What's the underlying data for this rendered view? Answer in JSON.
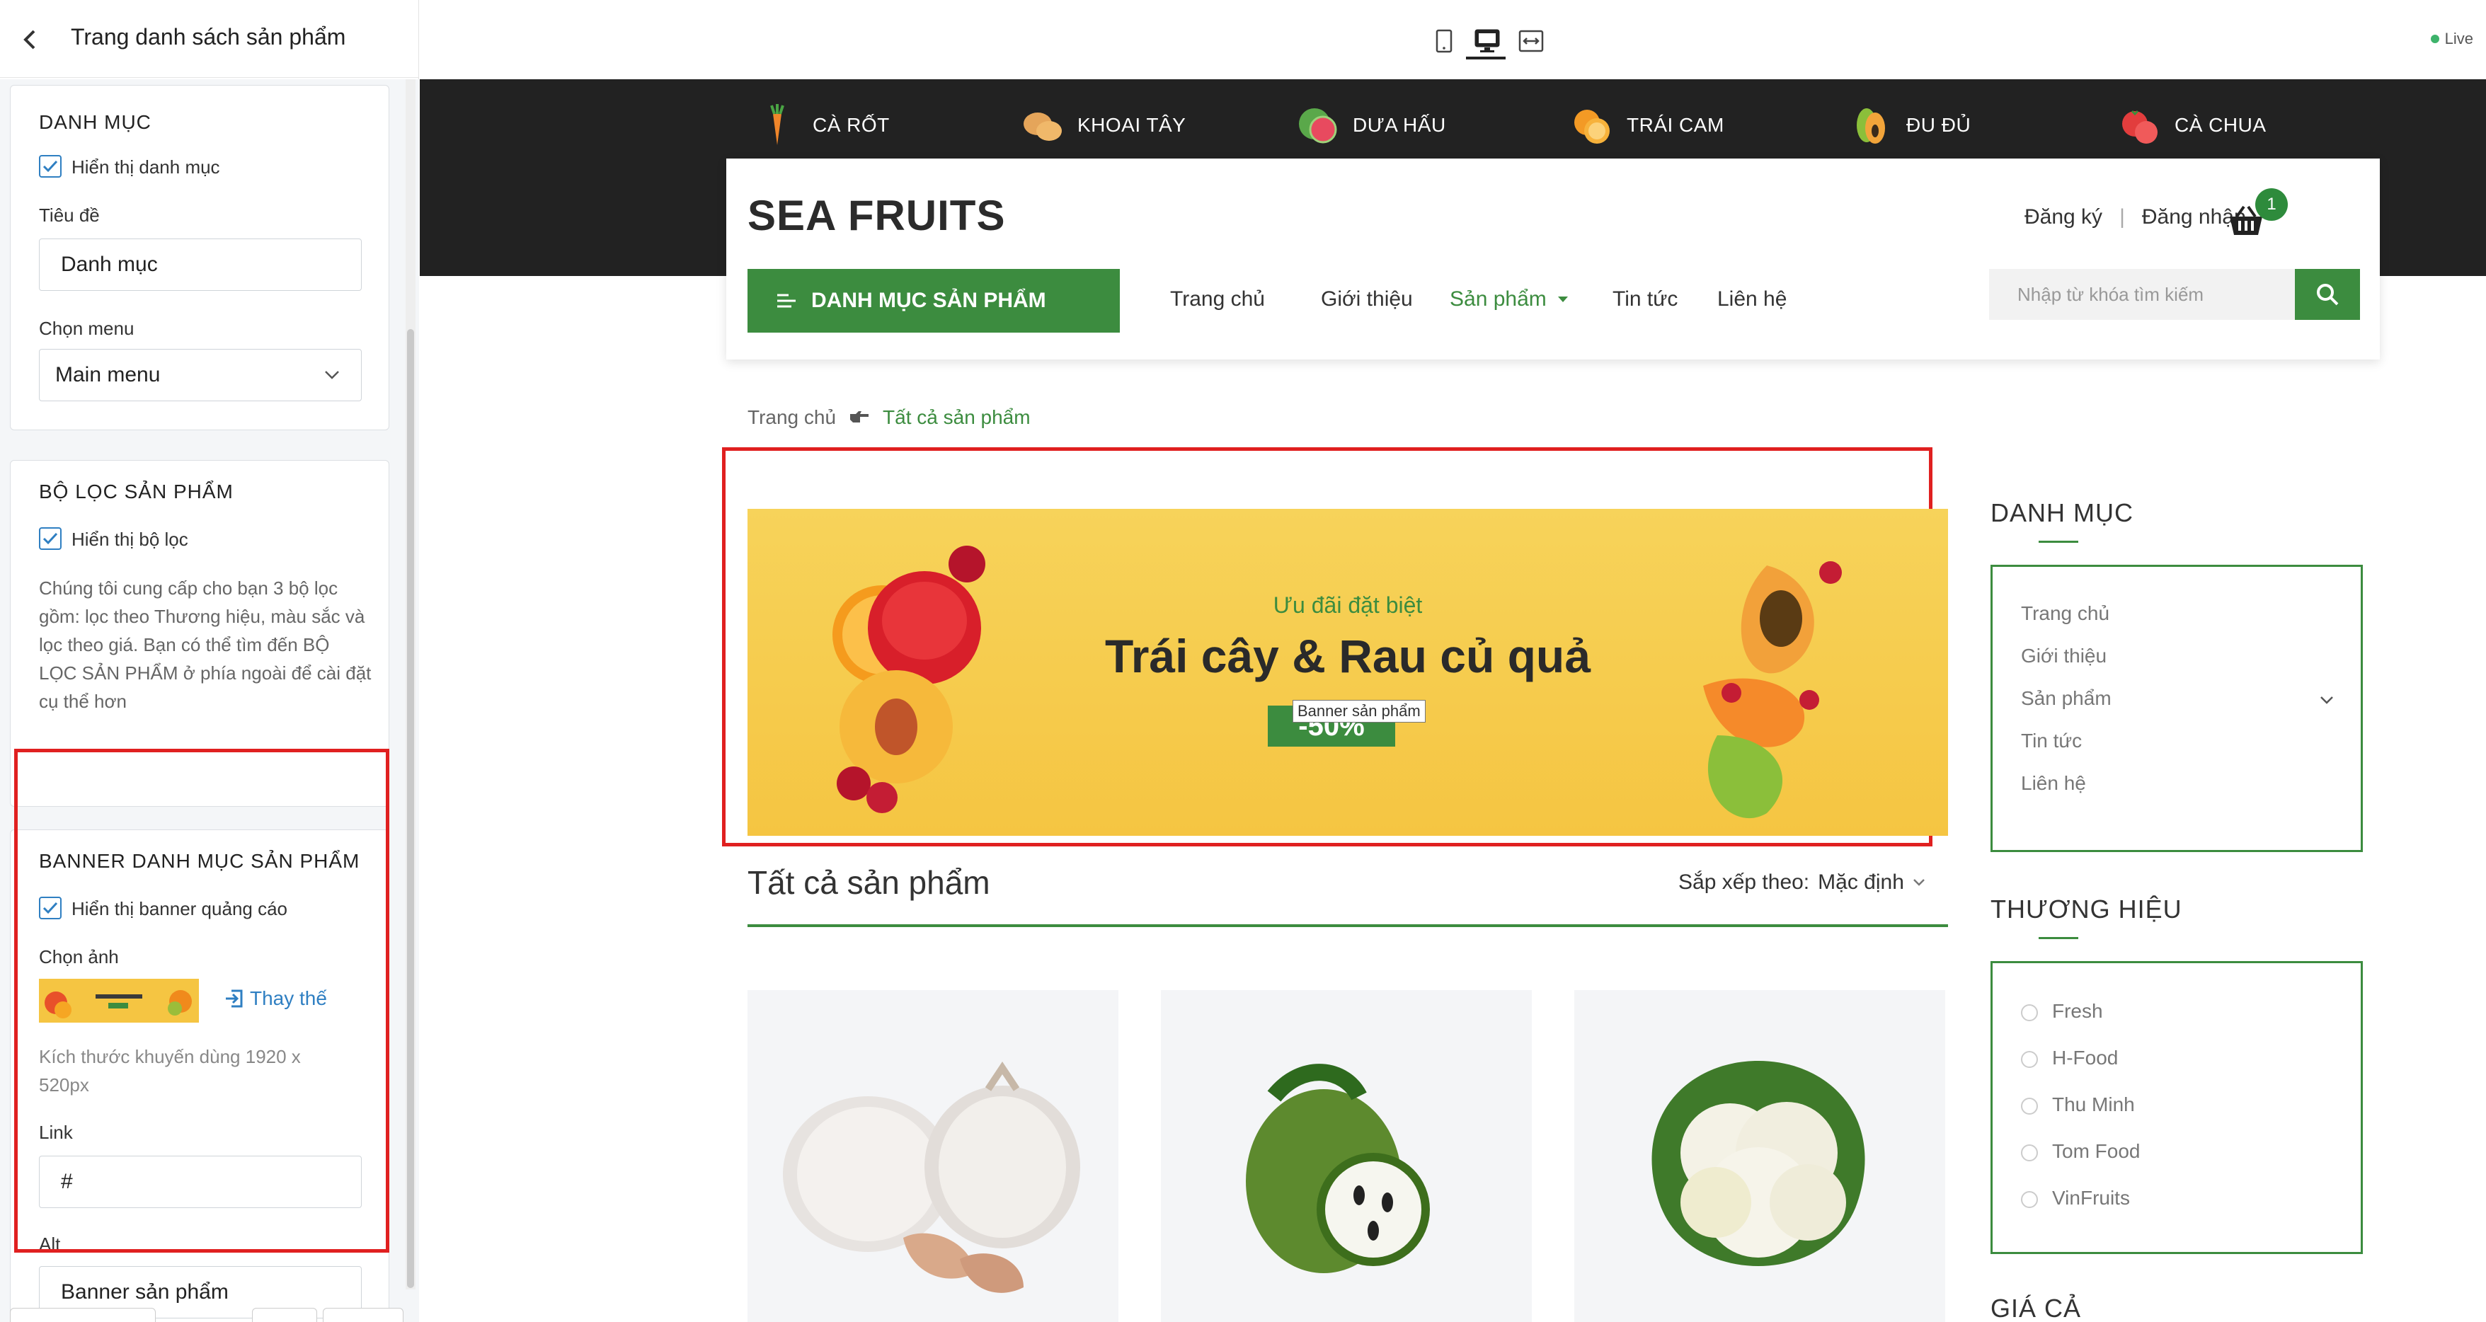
{
  "editor": {
    "title": "Trang danh sách sản phẩm",
    "category_card": {
      "title": "DANH MỤC",
      "show_label": "Hiển thị danh mục",
      "heading_label": "Tiêu đề",
      "heading_value": "Danh mục",
      "menu_label": "Chọn menu",
      "menu_value": "Main menu"
    },
    "filter_card": {
      "title": "BỘ LỌC SẢN PHẨM",
      "show_label": "Hiển thị bộ lọc",
      "help": "Chúng tôi cung cấp cho bạn 3 bộ lọc gồm: lọc theo Thương hiệu, màu sắc và lọc theo giá. Bạn có thể tìm đến BỘ LỌC SẢN PHẨM ở phía ngoài để cài đặt cụ thể hơn"
    },
    "banner_card": {
      "title": "BANNER DANH MỤC SẢN PHẨM",
      "show_label": "Hiển thị banner quảng cáo",
      "image_label": "Chọn ảnh",
      "replace_label": "Thay thế",
      "size_hint": "Kích thước khuyến dùng 1920 x 520px",
      "link_label": "Link",
      "link_value": "#",
      "alt_label": "Alt",
      "alt_value": "Banner sản phẩm"
    }
  },
  "toolbar": {
    "live_label": "Live",
    "icons": [
      "mobile-icon",
      "desktop-icon",
      "fullwidth-icon"
    ]
  },
  "store": {
    "fruit_nav": [
      {
        "label": "CÀ RỐT",
        "icon": "carrot-icon"
      },
      {
        "label": "KHOAI TÂY",
        "icon": "potato-icon"
      },
      {
        "label": "DƯA HẤU",
        "icon": "watermelon-icon"
      },
      {
        "label": "TRÁI CAM",
        "icon": "orange-icon"
      },
      {
        "label": "ĐU ĐỦ",
        "icon": "papaya-icon"
      },
      {
        "label": "CÀ CHUA",
        "icon": "tomato-icon"
      }
    ],
    "logo": "SEA FRUITS",
    "register": "Đăng ký",
    "auth_sep": "|",
    "login": "Đăng nhập",
    "cart_count": "1",
    "category_button": "DANH MỤC SẢN PHẨM",
    "nav": [
      "Trang chủ",
      "Giới thiệu",
      "Sản phẩm",
      "Tin tức",
      "Liên hệ"
    ],
    "search_placeholder": "Nhập từ khóa tìm kiếm",
    "breadcrumb": {
      "home": "Trang chủ",
      "current": "Tất cả sản phẩm"
    },
    "banner": {
      "subtitle": "Ưu đãi đặt biệt",
      "title": "Trái cây & Rau củ quả",
      "cta": "-50%",
      "tooltip": "Banner sản phẩm"
    },
    "list_title": "Tất cả sản phẩm",
    "sort_label": "Sắp xếp theo:",
    "sort_value": "Mặc định",
    "products": [
      {
        "name": "garlic"
      },
      {
        "name": "soursop"
      },
      {
        "name": "cauliflower"
      }
    ],
    "sidebar": {
      "category_title": "DANH MỤC",
      "category_items": [
        "Trang chủ",
        "Giới thiệu",
        "Sản phẩm",
        "Tin tức",
        "Liên hệ"
      ],
      "brand_title": "THƯƠNG HIỆU",
      "brands": [
        "Fresh",
        "H-Food",
        "Thu Minh",
        "Tom Food",
        "VinFruits"
      ],
      "price_title": "GIÁ CẢ"
    }
  },
  "colors": {
    "accent_green": "#3c8c3f",
    "highlight_red": "#e02020",
    "banner_yellow": "#f5c542",
    "top_band": "#222222"
  }
}
